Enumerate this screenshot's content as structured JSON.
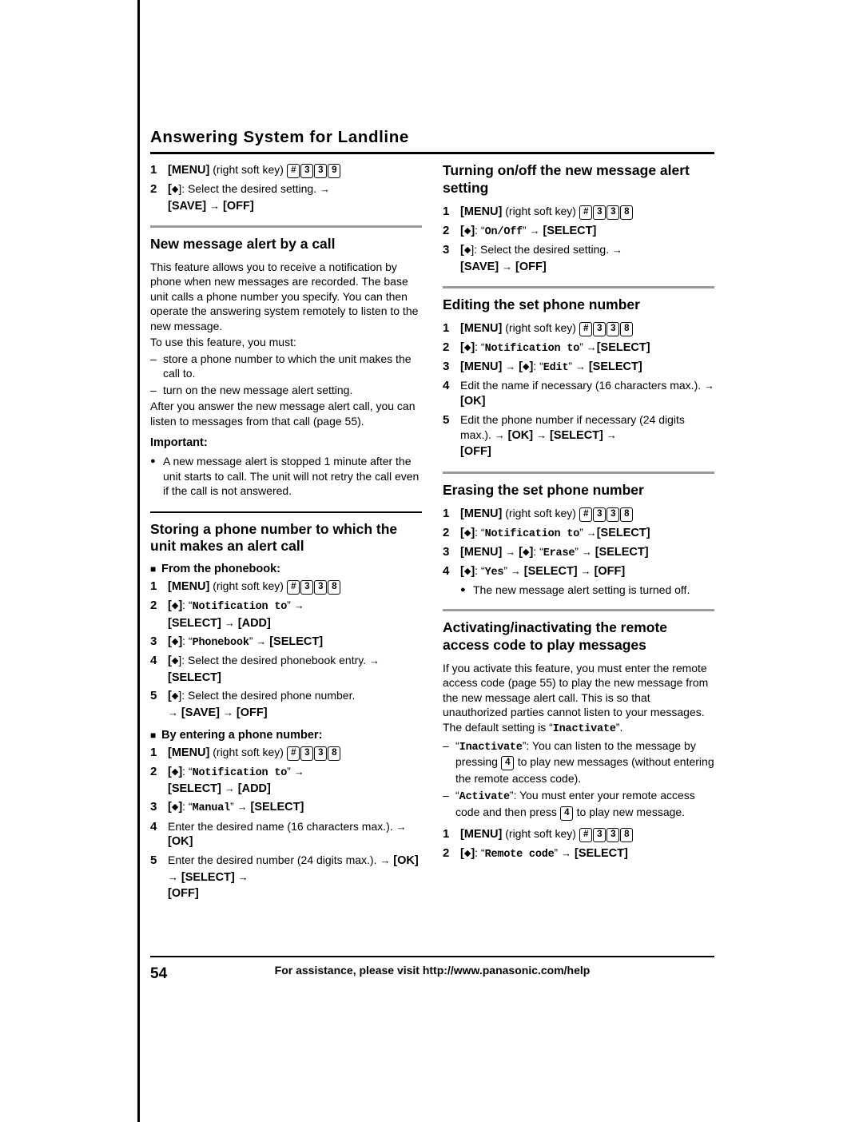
{
  "page": {
    "header": "Answering System for Landline",
    "number": "54",
    "footer": "For assistance, please visit http://www.panasonic.com/help"
  },
  "left": {
    "top_steps": [
      {
        "num": "1",
        "pre": "[MENU]",
        "mid": " (right soft key) ",
        "keys": [
          "#",
          "3",
          "3",
          "9"
        ]
      },
      {
        "num": "2",
        "text_a": "]: Select the desired setting. ",
        "text_b": "[SAVE] ",
        "text_c": "[OFF]"
      }
    ],
    "section1": {
      "title": "New message alert by a call",
      "para1": "This feature allows you to receive a notification by phone when new messages are recorded. The base unit calls a phone number you specify. You can then operate the answering system remotely to listen to the new message.",
      "para2": "To use this feature, you must:",
      "dashes": [
        "store a phone number to which the unit makes the call to.",
        "turn on the new message alert setting."
      ],
      "para3": "After you answer the new message alert call, you can listen to messages from that call (page 55).",
      "important_label": "Important:",
      "important_bullet": "A new message alert is stopped 1 minute after the unit starts to call. The unit will not retry the call even if the call is not answered."
    },
    "section2": {
      "title": "Storing a phone number to which the unit makes an alert call",
      "sub1": "From the phonebook:",
      "sub1_steps": [
        {
          "num": "1",
          "pre": "[MENU]",
          "mid": " (right soft key) ",
          "keys": [
            "#",
            "3",
            "3",
            "8"
          ]
        },
        {
          "num": "2",
          "quote": "Notification to",
          "tail_a": "[SELECT] ",
          "tail_b": "[ADD]"
        },
        {
          "num": "3",
          "quote": "Phonebook",
          "tail_a": "[SELECT]"
        },
        {
          "num": "4",
          "text": "]: Select the desired phonebook entry. ",
          "tail": "[SELECT]"
        },
        {
          "num": "5",
          "text": "]: Select the desired phone number. ",
          "tail_a": "[SAVE] ",
          "tail_b": "[OFF]"
        }
      ],
      "sub2": "By entering a phone number:",
      "sub2_steps": [
        {
          "num": "1",
          "pre": "[MENU]",
          "mid": " (right soft key) ",
          "keys": [
            "#",
            "3",
            "3",
            "8"
          ]
        },
        {
          "num": "2",
          "quote": "Notification to",
          "tail_a": "[SELECT] ",
          "tail_b": "[ADD]"
        },
        {
          "num": "3",
          "quote": "Manual",
          "tail_a": "[SELECT]"
        },
        {
          "num": "4",
          "text": "Enter the desired name (16 characters max.). ",
          "tail": "[OK]"
        },
        {
          "num": "5",
          "text": "Enter the desired number (24 digits max.). ",
          "tail_a": "[OK] ",
          "tail_b": "[SELECT] ",
          "tail_c": "[OFF]"
        }
      ]
    }
  },
  "right": {
    "section1": {
      "title": "Turning on/off the new message alert setting",
      "steps": [
        {
          "num": "1",
          "pre": "[MENU]",
          "mid": " (right soft key) ",
          "keys": [
            "#",
            "3",
            "3",
            "8"
          ]
        },
        {
          "num": "2",
          "quote": "On/Off",
          "tail_a": "[SELECT]"
        },
        {
          "num": "3",
          "text": "]: Select the desired setting. ",
          "tail_a": "[SAVE] ",
          "tail_b": "[OFF]"
        }
      ]
    },
    "section2": {
      "title": "Editing the set phone number",
      "steps": [
        {
          "num": "1",
          "pre": "[MENU]",
          "mid": " (right soft key) ",
          "keys": [
            "#",
            "3",
            "3",
            "8"
          ]
        },
        {
          "num": "2",
          "quote": "Notification to",
          "tail_a": "[SELECT]"
        },
        {
          "num": "3",
          "pre": "[MENU]",
          "quote": "Edit",
          "tail_a": "[SELECT]"
        },
        {
          "num": "4",
          "text": "Edit the name if necessary (16 characters max.). ",
          "tail": "[OK]"
        },
        {
          "num": "5",
          "text": "Edit the phone number if necessary (24 digits max.). ",
          "tail_a": "[OK] ",
          "tail_b": "[SELECT] ",
          "tail_c": "[OFF]"
        }
      ]
    },
    "section3": {
      "title": "Erasing the set phone number",
      "steps": [
        {
          "num": "1",
          "pre": "[MENU]",
          "mid": " (right soft key) ",
          "keys": [
            "#",
            "3",
            "3",
            "8"
          ]
        },
        {
          "num": "2",
          "quote": "Notification to",
          "tail_a": "[SELECT]"
        },
        {
          "num": "3",
          "pre": "[MENU]",
          "quote": "Erase",
          "tail_a": "[SELECT]"
        },
        {
          "num": "4",
          "quote": "Yes",
          "tail_a": "[SELECT] ",
          "tail_b": "[OFF]"
        }
      ],
      "note_bullet": "The new message alert setting is turned off."
    },
    "section4": {
      "title": "Activating/inactivating the remote access code to play messages",
      "para1_a": "If you activate this feature, you must enter the remote access code (page 55) to play the new message from the new message alert call. This is so that unauthorized parties cannot listen to your messages. The default setting is ",
      "para1_quote": "Inactivate",
      "para1_b": ".",
      "dash1_quote": "Inactivate",
      "dash1_a": ": You can listen to the message by pressing ",
      "dash1_key": "4",
      "dash1_b": " to play new messages (without entering the remote access code).",
      "dash2_quote": "Activate",
      "dash2_a": ": You must enter your remote access code and then press ",
      "dash2_key": "4",
      "dash2_b": " to play new message.",
      "steps": [
        {
          "num": "1",
          "pre": "[MENU]",
          "mid": " (right soft key) ",
          "keys": [
            "#",
            "3",
            "3",
            "8"
          ]
        },
        {
          "num": "2",
          "quote": "Remote code",
          "tail_a": "[SELECT]"
        }
      ]
    }
  }
}
